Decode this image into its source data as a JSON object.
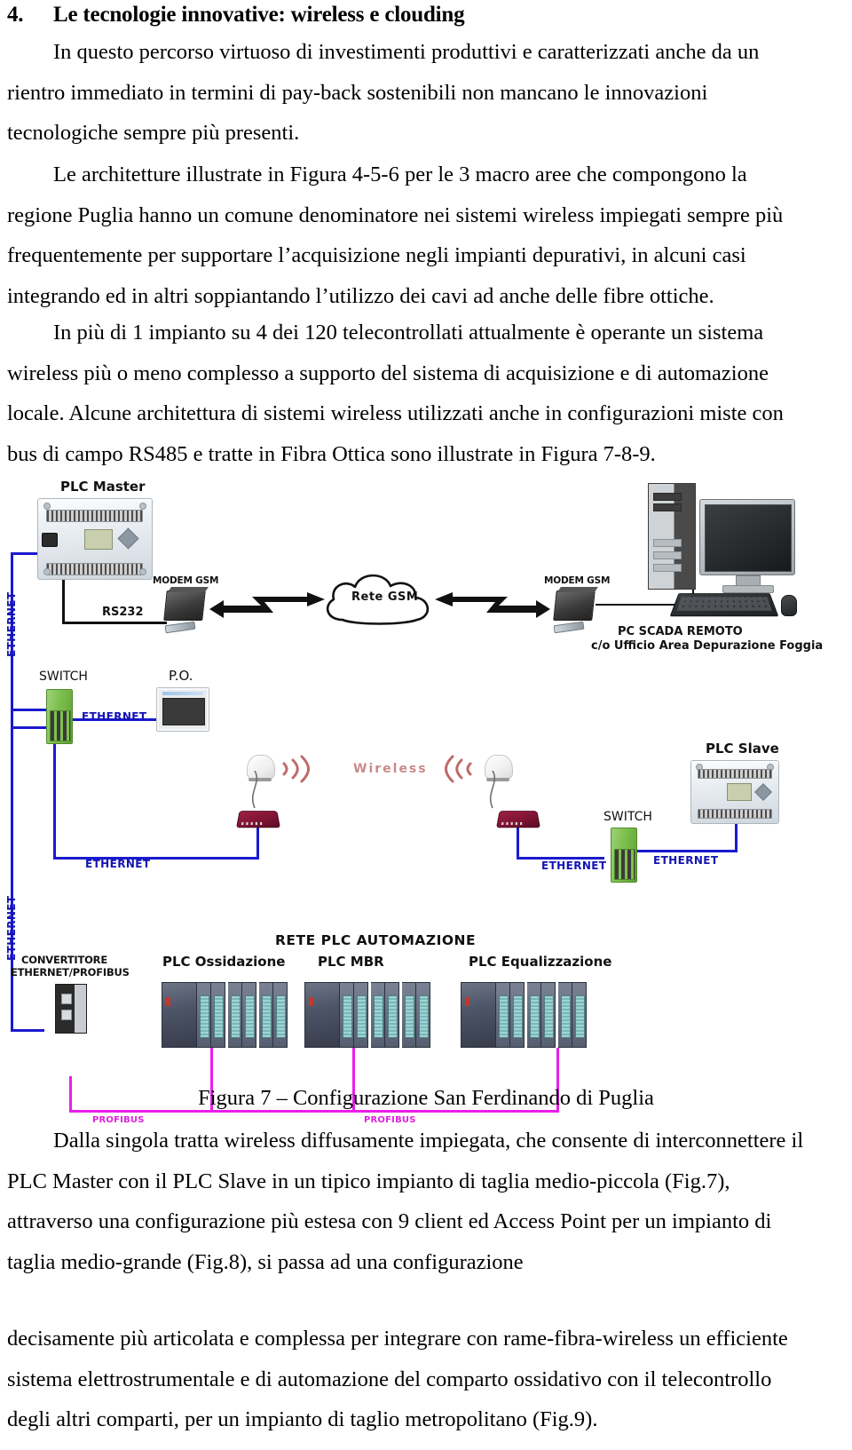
{
  "heading": {
    "number": "4.",
    "text": "Le tecnologie innovative: wireless e clouding"
  },
  "paragraphs": {
    "p1": "In questo percorso virtuoso di investimenti produttivi e caratterizzati anche da un rientro immediato in termini di pay-back sostenibili non mancano le innovazioni tecnologiche sempre più presenti.",
    "p2": "Le architetture illustrate in Figura 4-5-6 per le 3 macro aree che compongono la regione Puglia hanno un comune denominatore nei sistemi wireless impiegati sempre più frequentemente per supportare l’acquisizione negli impianti depurativi, in alcuni casi integrando ed in altri soppiantando l’utilizzo dei cavi ad anche delle fibre ottiche.",
    "p3": "In più di 1 impianto su 4 dei 120 telecontrollati attualmente è operante un sistema wireless più o meno complesso a supporto del sistema di acquisizione e di automazione locale. Alcune architettura di sistemi wireless utilizzati anche in configurazioni miste con bus di campo RS485 e tratte in Fibra Ottica sono illustrate in Figura 7-8-9.",
    "p4": "Dalla singola tratta wireless diffusamente impiegata, che consente di interconnettere il PLC Master con il PLC Slave in un tipico impianto di taglia medio-piccola (Fig.7), attraverso una configurazione più estesa con 9 client ed Access Point per un impianto di taglia medio-grande (Fig.8), si passa  ad una configurazione",
    "p5": "decisamente più articolata e complessa per integrare con rame-fibra-wireless un efficiente sistema elettrostrumentale e di automazione del comparto ossidativo con il telecontrollo degli altri comparti, per un impianto di taglio metropolitano (Fig.9)."
  },
  "figure": {
    "caption": "Figura 7 – Configurazione San Ferdinando di Puglia",
    "labels": {
      "plc_master": "PLC Master",
      "rs232": "RS232",
      "modem_gsm_left": "MODEM GSM",
      "modem_gsm_right": "MODEM GSM",
      "rete_gsm": "Rete  GSM",
      "pc_scada_line1": "PC SCADA REMOTO",
      "pc_scada_line2": "c/o Ufficio Area Depurazione Foggia",
      "switch_left": "SWITCH",
      "switch_right": "SWITCH",
      "po": "P.O.",
      "wireless": "Wireless",
      "plc_slave": "PLC Slave",
      "ethernet_vert_top": "ETHERNET",
      "ethernet_vert_bottom": "ETHERNET",
      "ethernet_po": "ETHERNET",
      "ethernet_bottom_left": "ETHERNET",
      "ethernet_ap_right": "ETHERNET",
      "ethernet_switch_right": "ETHERNET",
      "convertitore_line1": "CONVERTITORE",
      "convertitore_line2": "ETHERNET/PROFIBUS",
      "rete_plc": "RETE PLC AUTOMAZIONE",
      "plc_ossidazione": "PLC Ossidazione",
      "plc_mbr": "PLC MBR",
      "plc_equalizzazione": "PLC Equalizzazione",
      "profibus_left": "PROFIBUS",
      "profibus_right": "PROFIBUS"
    },
    "colors": {
      "ethernet": "#1414b4",
      "profibus": "#e020e0",
      "wireless": "#c98a8a",
      "wire_black": "#111111"
    }
  }
}
